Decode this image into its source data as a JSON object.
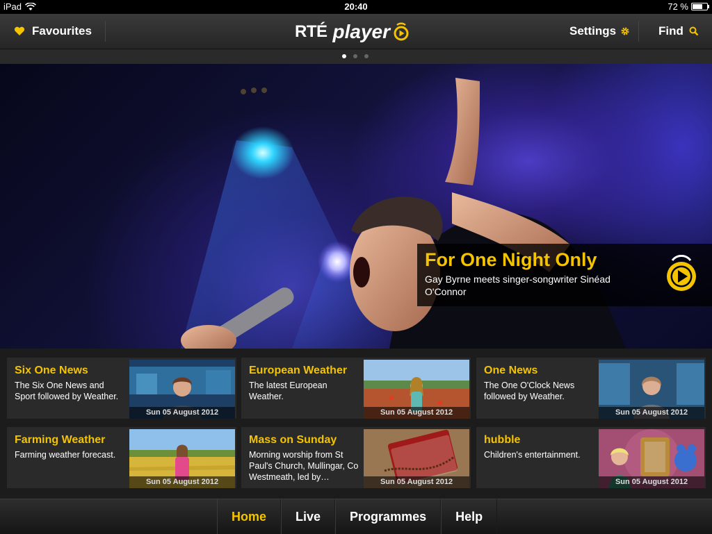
{
  "status": {
    "device": "iPad",
    "time": "20:40",
    "battery": "72 %",
    "battery_level": 0.72
  },
  "header": {
    "favourites_label": "Favourites",
    "logo_rte": "RTÉ",
    "logo_player": "player",
    "settings_label": "Settings",
    "find_label": "Find"
  },
  "carousel": {
    "pages": 3,
    "current": 1
  },
  "hero": {
    "title": "For One Night Only",
    "subtitle": "Gay Byrne meets singer-songwriter Sinéad O'Connor"
  },
  "programmes": [
    {
      "title": "Six One News",
      "desc": "The Six One News and Sport followed by Weather.",
      "date": "Sun 05 August 2012",
      "thumb": "news-studio"
    },
    {
      "title": "European Weather",
      "desc": "The latest European Weather.",
      "date": "Sun 05 August 2012",
      "thumb": "field"
    },
    {
      "title": "One News",
      "desc": "The One O'Clock News followed by Weather.",
      "date": "Sun 05 August 2012",
      "thumb": "news-studio"
    },
    {
      "title": "Farming Weather",
      "desc": "Farming weather forecast.",
      "date": "Sun 05 August 2012",
      "thumb": "wheat-field"
    },
    {
      "title": "Mass on Sunday",
      "desc": "Morning worship from St Paul's Church, Mullingar, Co Westmeath, led by…",
      "date": "Sun 05 August 2012",
      "thumb": "bible"
    },
    {
      "title": "hubble",
      "desc": "Children's entertainment.",
      "date": "Sun 05 August 2012",
      "thumb": "kids-set"
    }
  ],
  "nav": {
    "tabs": [
      "Home",
      "Live",
      "Programmes",
      "Help"
    ],
    "active": "Home"
  },
  "colors": {
    "accent": "#f5c400",
    "background": "#1c1c1c"
  }
}
